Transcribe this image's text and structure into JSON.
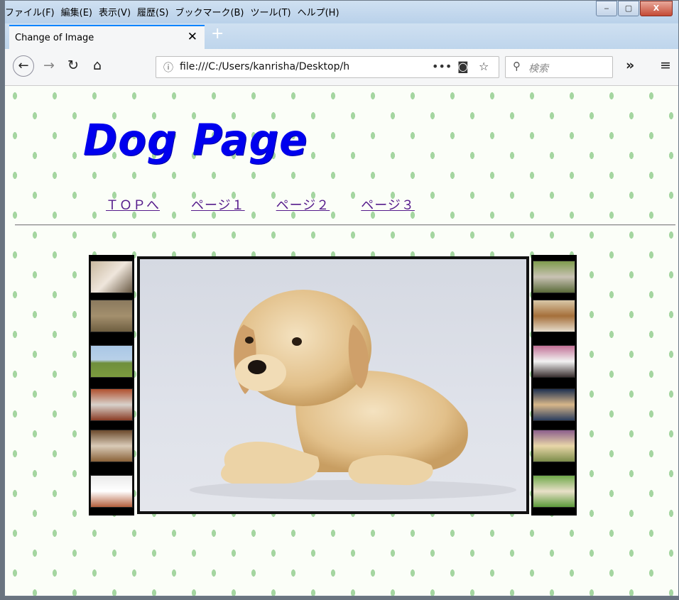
{
  "browser": {
    "menu": [
      "ファイル(F)",
      "編集(E)",
      "表示(V)",
      "履歴(S)",
      "ブックマーク(B)",
      "ツール(T)",
      "ヘルプ(H)"
    ],
    "tab_title": "Change of Image",
    "url": "file:///C:/Users/kanrisha/Desktop/h",
    "search_placeholder": "検索",
    "window_buttons": {
      "minimize": "‒",
      "maximize": "▢",
      "close": "X"
    }
  },
  "page": {
    "logo": "Dog Page",
    "nav": [
      "ＴＯＰへ",
      "ページ１",
      "ページ２",
      "ページ３"
    ],
    "thumbnails_left": [
      "dog-photo-1",
      "dog-photo-2",
      "dog-photo-3",
      "dog-photo-4",
      "dog-photo-5",
      "dog-photo-6"
    ],
    "thumbnails_right": [
      "dog-photo-7",
      "dog-photo-8",
      "dog-photo-9",
      "dog-photo-10",
      "dog-photo-11",
      "dog-photo-12"
    ],
    "main_image": "puppy-photo"
  },
  "colors": {
    "logo": "#0000ee",
    "link": "#551a8b",
    "pattern": "#a5d6a1"
  }
}
